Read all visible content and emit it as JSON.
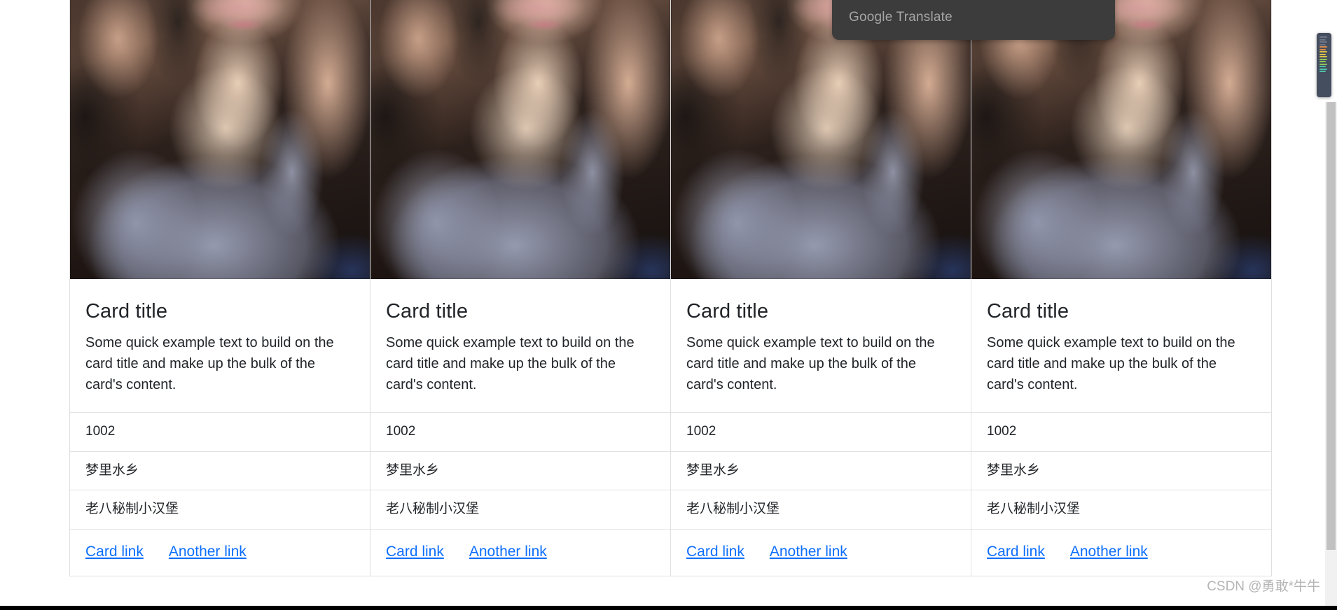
{
  "page": {
    "background_color": "#ffffff",
    "accent_link_color": "#0d6efd",
    "border_color": "#dfdfdf"
  },
  "overlay": {
    "google_translate": {
      "label": "Google Translate",
      "background_color": "#3c3c3c",
      "text_color": "#a6a6a6"
    }
  },
  "cards": [
    {
      "image_alt": "portrait-photo",
      "title": "Card title",
      "text": "Some quick example text to build on the card title and make up the bulk of the card's content.",
      "list_items": [
        "1002",
        "梦里水乡",
        "老八秘制小汉堡"
      ],
      "links": [
        "Card link",
        "Another link"
      ]
    },
    {
      "image_alt": "portrait-photo",
      "title": "Card title",
      "text": "Some quick example text to build on the card title and make up the bulk of the card's content.",
      "list_items": [
        "1002",
        "梦里水乡",
        "老八秘制小汉堡"
      ],
      "links": [
        "Card link",
        "Another link"
      ]
    },
    {
      "image_alt": "portrait-photo",
      "title": "Card title",
      "text": "Some quick example text to build on the card title and make up the bulk of the card's content.",
      "list_items": [
        "1002",
        "梦里水乡",
        "老八秘制小汉堡"
      ],
      "links": [
        "Card link",
        "Another link"
      ]
    },
    {
      "image_alt": "portrait-photo",
      "title": "Card title",
      "text": "Some quick example text to build on the card title and make up the bulk of the card's content.",
      "list_items": [
        "1002",
        "梦里水乡",
        "老八秘制小汉堡"
      ],
      "links": [
        "Card link",
        "Another link"
      ]
    }
  ],
  "watermark": {
    "text": "CSDN @勇敢*牛牛"
  },
  "scrollbar": {
    "track_color": "#f1f1f1",
    "thumb_color": "#c1c1c1"
  },
  "minimap": {
    "background_color": "#454e5e"
  }
}
